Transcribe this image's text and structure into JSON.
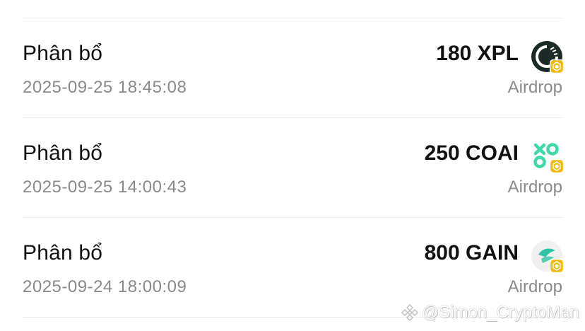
{
  "transactions": [
    {
      "type": "Phân bổ",
      "timestamp": "2025-09-25 18:45:08",
      "amount": "180 XPL",
      "source": "Airdrop",
      "icon": "xpl-token-icon"
    },
    {
      "type": "Phân bổ",
      "timestamp": "2025-09-25 14:00:43",
      "amount": "250 COAI",
      "source": "Airdrop",
      "icon": "coai-token-icon"
    },
    {
      "type": "Phân bổ",
      "timestamp": "2025-09-24 18:00:09",
      "amount": "800 GAIN",
      "source": "Airdrop",
      "icon": "gain-token-icon"
    }
  ],
  "watermark": {
    "text": "@Simon_CryptoMan"
  },
  "colors": {
    "text_primary": "#111111",
    "text_secondary": "#8a8a8a",
    "divider": "#ebebeb",
    "bnb_yellow": "#f0b90b",
    "coai_green": "#3dd9a8",
    "gain_teal": "#2ec4a6"
  }
}
